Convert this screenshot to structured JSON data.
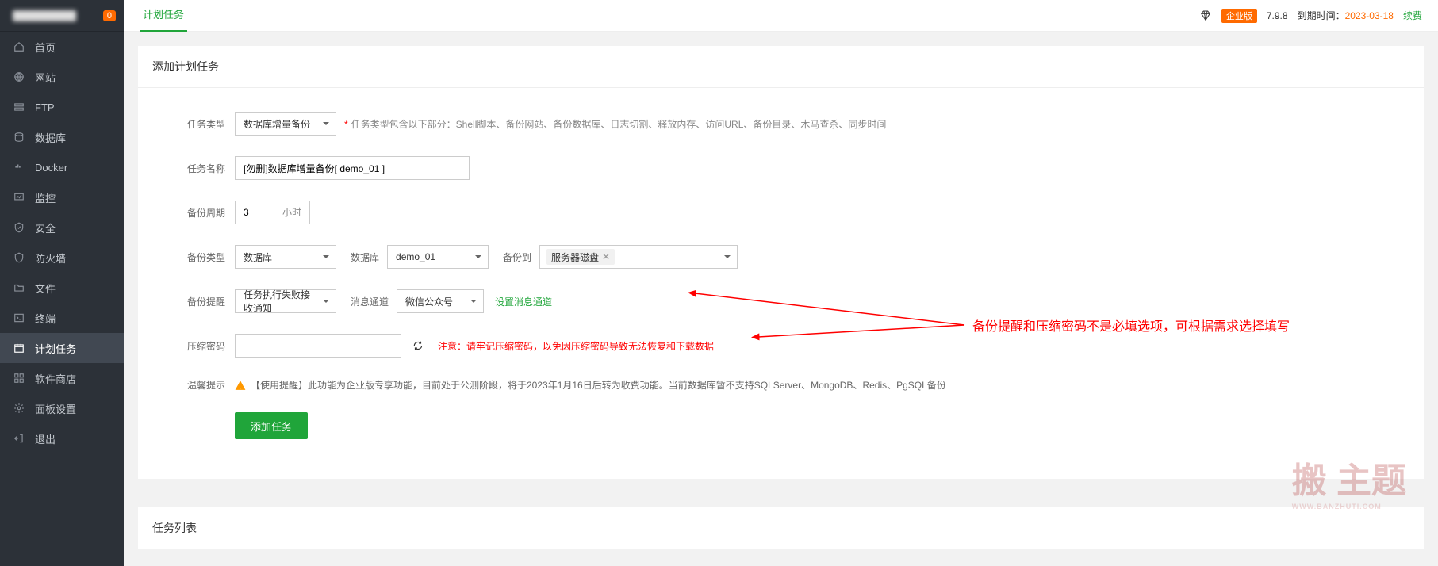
{
  "sidebar": {
    "badge": "0",
    "items": [
      {
        "label": "首页"
      },
      {
        "label": "网站"
      },
      {
        "label": "FTP"
      },
      {
        "label": "数据库"
      },
      {
        "label": "Docker"
      },
      {
        "label": "监控"
      },
      {
        "label": "安全"
      },
      {
        "label": "防火墙"
      },
      {
        "label": "文件"
      },
      {
        "label": "终端"
      },
      {
        "label": "计划任务"
      },
      {
        "label": "软件商店"
      },
      {
        "label": "面板设置"
      },
      {
        "label": "退出"
      }
    ]
  },
  "topbar": {
    "tab": "计划任务",
    "edition": "企业版",
    "version": "7.9.8",
    "expire_label": "到期时间：",
    "expire_date": "2023-03-18",
    "renew": "续费"
  },
  "panel": {
    "title": "添加计划任务",
    "list_title": "任务列表"
  },
  "form": {
    "task_type": {
      "label": "任务类型",
      "value": "数据库增量备份",
      "hint": "任务类型包含以下部分：Shell脚本、备份网站、备份数据库、日志切割、释放内存、访问URL、备份目录、木马查杀、同步时间"
    },
    "task_name": {
      "label": "任务名称",
      "value": "[勿删]数据库增量备份[ demo_01 ]"
    },
    "backup_cycle": {
      "label": "备份周期",
      "value": "3",
      "unit": "小时"
    },
    "backup_type": {
      "label": "备份类型",
      "value": "数据库",
      "db_label": "数据库",
      "db_value": "demo_01",
      "dest_label": "备份到",
      "dest_value": "服务器磁盘"
    },
    "backup_remind": {
      "label": "备份提醒",
      "value": "任务执行失败接收通知",
      "channel_label": "消息通道",
      "channel_value": "微信公众号",
      "config_link": "设置消息通道"
    },
    "compress_pwd": {
      "label": "压缩密码",
      "note": "注意：请牢记压缩密码，以免因压缩密码导致无法恢复和下载数据"
    },
    "tip": {
      "label": "温馨提示",
      "text": "【使用提醒】此功能为企业版专享功能，目前处于公测阶段，将于2023年1月16日后转为收费功能。当前数据库暂不支持SQLServer、MongoDB、Redis、PgSQL备份"
    },
    "submit": "添加任务"
  },
  "annotation": "备份提醒和压缩密码不是必填选项，可根据需求选择填写"
}
